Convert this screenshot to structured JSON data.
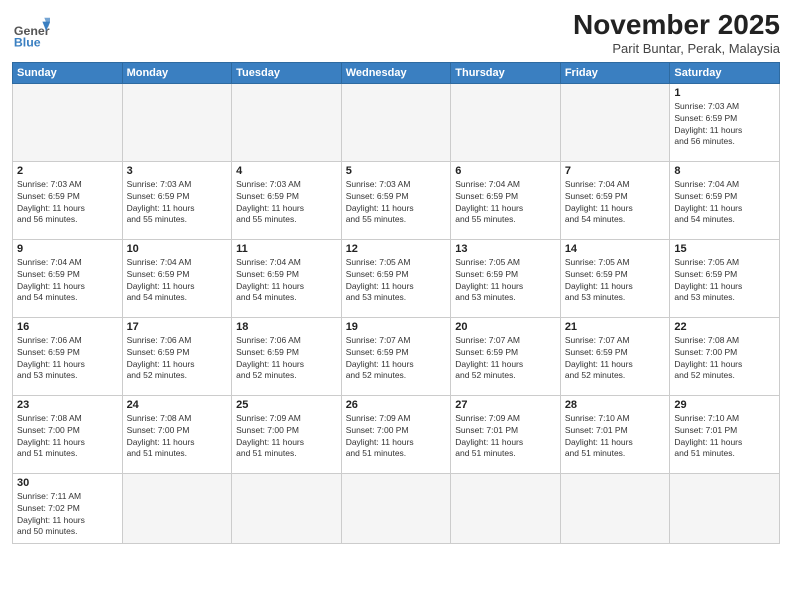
{
  "header": {
    "logo_general": "General",
    "logo_blue": "Blue",
    "month_title": "November 2025",
    "location": "Parit Buntar, Perak, Malaysia"
  },
  "weekdays": [
    "Sunday",
    "Monday",
    "Tuesday",
    "Wednesday",
    "Thursday",
    "Friday",
    "Saturday"
  ],
  "weeks": [
    [
      {
        "day": "",
        "info": ""
      },
      {
        "day": "",
        "info": ""
      },
      {
        "day": "",
        "info": ""
      },
      {
        "day": "",
        "info": ""
      },
      {
        "day": "",
        "info": ""
      },
      {
        "day": "",
        "info": ""
      },
      {
        "day": "1",
        "info": "Sunrise: 7:03 AM\nSunset: 6:59 PM\nDaylight: 11 hours\nand 56 minutes."
      }
    ],
    [
      {
        "day": "2",
        "info": "Sunrise: 7:03 AM\nSunset: 6:59 PM\nDaylight: 11 hours\nand 56 minutes."
      },
      {
        "day": "3",
        "info": "Sunrise: 7:03 AM\nSunset: 6:59 PM\nDaylight: 11 hours\nand 55 minutes."
      },
      {
        "day": "4",
        "info": "Sunrise: 7:03 AM\nSunset: 6:59 PM\nDaylight: 11 hours\nand 55 minutes."
      },
      {
        "day": "5",
        "info": "Sunrise: 7:03 AM\nSunset: 6:59 PM\nDaylight: 11 hours\nand 55 minutes."
      },
      {
        "day": "6",
        "info": "Sunrise: 7:04 AM\nSunset: 6:59 PM\nDaylight: 11 hours\nand 55 minutes."
      },
      {
        "day": "7",
        "info": "Sunrise: 7:04 AM\nSunset: 6:59 PM\nDaylight: 11 hours\nand 54 minutes."
      },
      {
        "day": "8",
        "info": "Sunrise: 7:04 AM\nSunset: 6:59 PM\nDaylight: 11 hours\nand 54 minutes."
      }
    ],
    [
      {
        "day": "9",
        "info": "Sunrise: 7:04 AM\nSunset: 6:59 PM\nDaylight: 11 hours\nand 54 minutes."
      },
      {
        "day": "10",
        "info": "Sunrise: 7:04 AM\nSunset: 6:59 PM\nDaylight: 11 hours\nand 54 minutes."
      },
      {
        "day": "11",
        "info": "Sunrise: 7:04 AM\nSunset: 6:59 PM\nDaylight: 11 hours\nand 54 minutes."
      },
      {
        "day": "12",
        "info": "Sunrise: 7:05 AM\nSunset: 6:59 PM\nDaylight: 11 hours\nand 53 minutes."
      },
      {
        "day": "13",
        "info": "Sunrise: 7:05 AM\nSunset: 6:59 PM\nDaylight: 11 hours\nand 53 minutes."
      },
      {
        "day": "14",
        "info": "Sunrise: 7:05 AM\nSunset: 6:59 PM\nDaylight: 11 hours\nand 53 minutes."
      },
      {
        "day": "15",
        "info": "Sunrise: 7:05 AM\nSunset: 6:59 PM\nDaylight: 11 hours\nand 53 minutes."
      }
    ],
    [
      {
        "day": "16",
        "info": "Sunrise: 7:06 AM\nSunset: 6:59 PM\nDaylight: 11 hours\nand 53 minutes."
      },
      {
        "day": "17",
        "info": "Sunrise: 7:06 AM\nSunset: 6:59 PM\nDaylight: 11 hours\nand 52 minutes."
      },
      {
        "day": "18",
        "info": "Sunrise: 7:06 AM\nSunset: 6:59 PM\nDaylight: 11 hours\nand 52 minutes."
      },
      {
        "day": "19",
        "info": "Sunrise: 7:07 AM\nSunset: 6:59 PM\nDaylight: 11 hours\nand 52 minutes."
      },
      {
        "day": "20",
        "info": "Sunrise: 7:07 AM\nSunset: 6:59 PM\nDaylight: 11 hours\nand 52 minutes."
      },
      {
        "day": "21",
        "info": "Sunrise: 7:07 AM\nSunset: 6:59 PM\nDaylight: 11 hours\nand 52 minutes."
      },
      {
        "day": "22",
        "info": "Sunrise: 7:08 AM\nSunset: 7:00 PM\nDaylight: 11 hours\nand 52 minutes."
      }
    ],
    [
      {
        "day": "23",
        "info": "Sunrise: 7:08 AM\nSunset: 7:00 PM\nDaylight: 11 hours\nand 51 minutes."
      },
      {
        "day": "24",
        "info": "Sunrise: 7:08 AM\nSunset: 7:00 PM\nDaylight: 11 hours\nand 51 minutes."
      },
      {
        "day": "25",
        "info": "Sunrise: 7:09 AM\nSunset: 7:00 PM\nDaylight: 11 hours\nand 51 minutes."
      },
      {
        "day": "26",
        "info": "Sunrise: 7:09 AM\nSunset: 7:00 PM\nDaylight: 11 hours\nand 51 minutes."
      },
      {
        "day": "27",
        "info": "Sunrise: 7:09 AM\nSunset: 7:01 PM\nDaylight: 11 hours\nand 51 minutes."
      },
      {
        "day": "28",
        "info": "Sunrise: 7:10 AM\nSunset: 7:01 PM\nDaylight: 11 hours\nand 51 minutes."
      },
      {
        "day": "29",
        "info": "Sunrise: 7:10 AM\nSunset: 7:01 PM\nDaylight: 11 hours\nand 51 minutes."
      }
    ],
    [
      {
        "day": "30",
        "info": "Sunrise: 7:11 AM\nSunset: 7:02 PM\nDaylight: 11 hours\nand 50 minutes."
      },
      {
        "day": "",
        "info": ""
      },
      {
        "day": "",
        "info": ""
      },
      {
        "day": "",
        "info": ""
      },
      {
        "day": "",
        "info": ""
      },
      {
        "day": "",
        "info": ""
      },
      {
        "day": "",
        "info": ""
      }
    ]
  ]
}
